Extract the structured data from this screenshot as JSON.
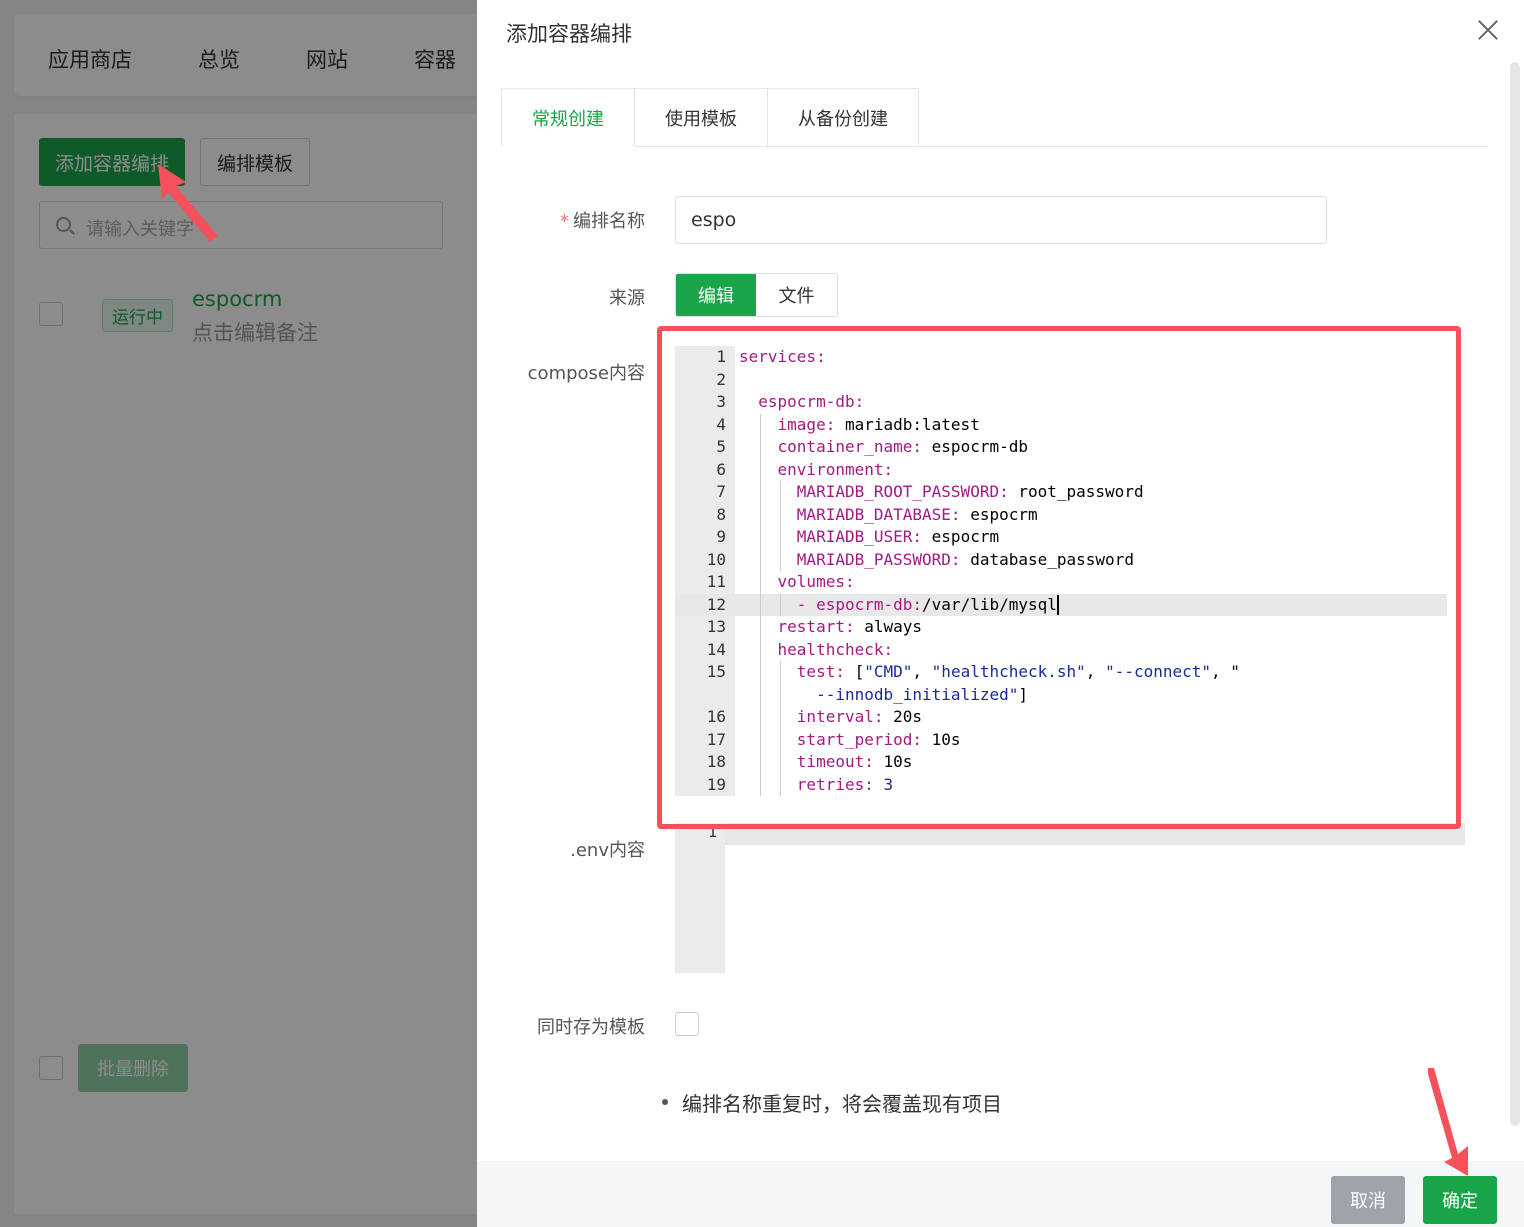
{
  "background": {
    "nav": [
      "应用商店",
      "总览",
      "网站",
      "容器"
    ],
    "add_button": "添加容器编排",
    "template_button": "编排模板",
    "search_placeholder": "请输入关键字",
    "project": {
      "status": "运行中",
      "name": "espocrm",
      "note": "点击编辑备注"
    },
    "bulk_delete": "批量删除"
  },
  "drawer": {
    "title": "添加容器编排",
    "tabs": [
      "常规创建",
      "使用模板",
      "从备份创建"
    ],
    "active_tab": 0,
    "labels": {
      "required_mark": "*",
      "name": "编排名称",
      "source": "来源",
      "compose": "compose内容",
      "env": ".env内容",
      "save_template": "同时存为模板"
    },
    "name_value": "espo",
    "source_options": [
      "编辑",
      "文件"
    ],
    "source_selected": 0,
    "compose_lines": [
      {
        "n": "1",
        "code": "services:"
      },
      {
        "n": "2",
        "code": ""
      },
      {
        "n": "3",
        "code": "  espocrm-db:"
      },
      {
        "n": "4",
        "code": "    image: mariadb:latest"
      },
      {
        "n": "5",
        "code": "    container_name: espocrm-db"
      },
      {
        "n": "6",
        "code": "    environment:"
      },
      {
        "n": "7",
        "code": "      MARIADB_ROOT_PASSWORD: root_password"
      },
      {
        "n": "8",
        "code": "      MARIADB_DATABASE: espocrm"
      },
      {
        "n": "9",
        "code": "      MARIADB_USER: espocrm"
      },
      {
        "n": "10",
        "code": "      MARIADB_PASSWORD: database_password"
      },
      {
        "n": "11",
        "code": "    volumes:"
      },
      {
        "n": "12",
        "code": "      - espocrm-db:/var/lib/mysql"
      },
      {
        "n": "13",
        "code": "    restart: always"
      },
      {
        "n": "14",
        "code": "    healthcheck:"
      },
      {
        "n": "15",
        "code": "      test: [\"CMD\", \"healthcheck.sh\", \"--connect\", \""
      },
      {
        "n": "",
        "code": "        --innodb_initialized\"]"
      },
      {
        "n": "16",
        "code": "      interval: 20s"
      },
      {
        "n": "17",
        "code": "      start_period: 10s"
      },
      {
        "n": "18",
        "code": "      timeout: 10s"
      },
      {
        "n": "19",
        "code": "      retries: 3"
      }
    ],
    "active_line": "12",
    "env_line_number": "1",
    "tip": "编排名称重复时，将会覆盖现有项目",
    "cancel": "取消",
    "confirm": "确定"
  },
  "colors": {
    "accent": "#1aa54a",
    "highlight": "#f4515c",
    "key": "#a31a84",
    "string": "#1a2a9a"
  }
}
